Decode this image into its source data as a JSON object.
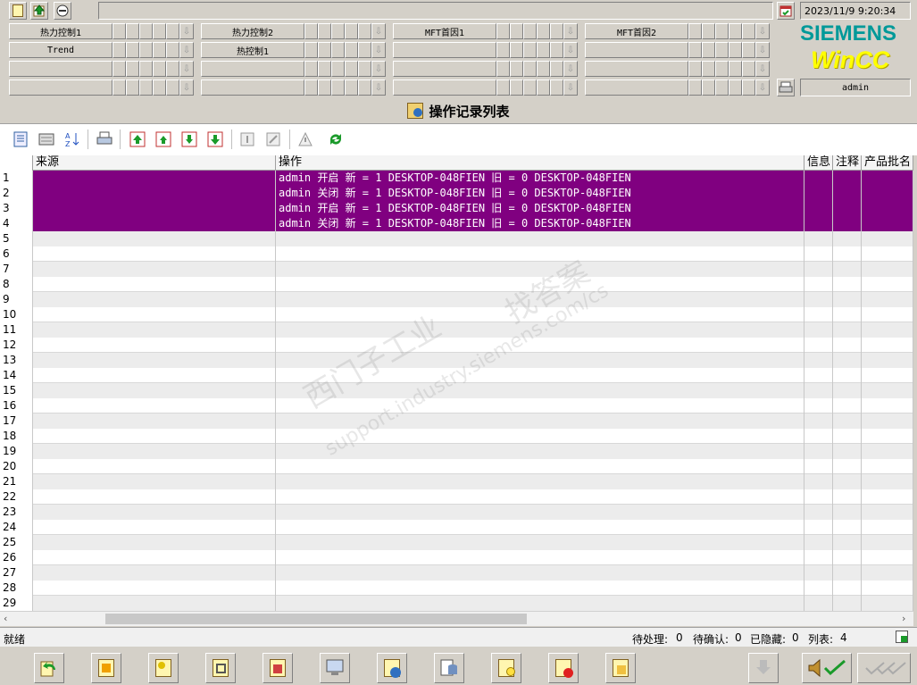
{
  "header": {
    "datetime": "2023/11/9 9:20:34",
    "user": "admin",
    "brand": "SIEMENS",
    "product": "WinCC"
  },
  "nav_groups": [
    {
      "label": "热力控制1"
    },
    {
      "label": "热力控制2"
    },
    {
      "label": "MFT首因1"
    },
    {
      "label": "MFT首因2"
    },
    {
      "label": "Trend"
    },
    {
      "label": "热控制1"
    },
    {
      "label": ""
    },
    {
      "label": ""
    },
    {
      "label": ""
    },
    {
      "label": ""
    },
    {
      "label": ""
    },
    {
      "label": ""
    },
    {
      "label": ""
    },
    {
      "label": ""
    },
    {
      "label": ""
    },
    {
      "label": ""
    }
  ],
  "page_title": "操作记录列表",
  "table": {
    "columns": [
      "来源",
      "操作",
      "信息",
      "注释",
      "产品批名"
    ],
    "rows": [
      {
        "n": "1",
        "source": "",
        "op": "admin 开启 新 = 1 DESKTOP-048FIEN 旧 = 0 DESKTOP-048FIEN"
      },
      {
        "n": "2",
        "source": "",
        "op": "admin 关闭 新 = 1 DESKTOP-048FIEN 旧 = 0 DESKTOP-048FIEN"
      },
      {
        "n": "3",
        "source": "",
        "op": "admin 开启 新 = 1 DESKTOP-048FIEN 旧 = 0 DESKTOP-048FIEN"
      },
      {
        "n": "4",
        "source": "",
        "op": "admin 关闭 新 = 1 DESKTOP-048FIEN 旧 = 0 DESKTOP-048FIEN"
      },
      {
        "n": "5",
        "op": ""
      },
      {
        "n": "6",
        "op": ""
      },
      {
        "n": "7",
        "op": ""
      },
      {
        "n": "8",
        "op": ""
      },
      {
        "n": "9",
        "op": ""
      },
      {
        "n": "10",
        "op": ""
      },
      {
        "n": "11",
        "op": ""
      },
      {
        "n": "12",
        "op": ""
      },
      {
        "n": "13",
        "op": ""
      },
      {
        "n": "14",
        "op": ""
      },
      {
        "n": "15",
        "op": ""
      },
      {
        "n": "16",
        "op": ""
      },
      {
        "n": "17",
        "op": ""
      },
      {
        "n": "18",
        "op": ""
      },
      {
        "n": "19",
        "op": ""
      },
      {
        "n": "20",
        "op": ""
      },
      {
        "n": "21",
        "op": ""
      },
      {
        "n": "22",
        "op": ""
      },
      {
        "n": "23",
        "op": ""
      },
      {
        "n": "24",
        "op": ""
      },
      {
        "n": "25",
        "op": ""
      },
      {
        "n": "26",
        "op": ""
      },
      {
        "n": "27",
        "op": ""
      },
      {
        "n": "28",
        "op": ""
      },
      {
        "n": "29",
        "op": ""
      }
    ]
  },
  "status": {
    "ready": "就绪",
    "pending_label": "待处理:",
    "pending": "0",
    "unack_label": "待确认:",
    "unack": "0",
    "hidden_label": "已隐藏:",
    "hidden": "0",
    "list_label": "列表:",
    "list": "4"
  },
  "watermark": {
    "line1": "西门子工业",
    "line2": "找答案",
    "line3": "support.industry.siemens.com/cs"
  },
  "colors": {
    "selected_row": "#800080",
    "siemens": "#009999",
    "wincc": "#ffff00",
    "toolbar_green": "#1a9a2a"
  }
}
